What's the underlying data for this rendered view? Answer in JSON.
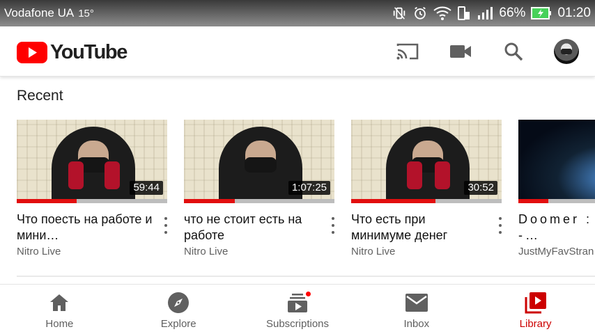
{
  "status_bar": {
    "carrier": "Vodafone UA",
    "temperature": "15°",
    "battery_pct": "66%",
    "time": "01:20"
  },
  "app_bar": {
    "logo_text": "YouTube",
    "icons": [
      "cast-icon",
      "camera-icon",
      "search-icon",
      "avatar"
    ]
  },
  "section": {
    "title": "Recent"
  },
  "videos": [
    {
      "title": "Что поесть на работе и мини…",
      "channel": "Nitro Live",
      "duration": "59:44",
      "progress": 0.4
    },
    {
      "title": "что не стоит есть на работе",
      "channel": "Nitro Live",
      "duration": "1:07:25",
      "progress": 0.34
    },
    {
      "title": "Что есть при минимуме денег",
      "channel": "Nitro Live",
      "duration": "30:52",
      "progress": 0.56
    },
    {
      "title": "Doomer : Кино -…",
      "channel": "JustMyFavStran",
      "duration": "",
      "progress": 0.2
    }
  ],
  "bottom_nav": [
    {
      "label": "Home",
      "icon": "home-icon",
      "active": false
    },
    {
      "label": "Explore",
      "icon": "compass-icon",
      "active": false
    },
    {
      "label": "Subscriptions",
      "icon": "subscriptions-icon",
      "active": false,
      "badge": true
    },
    {
      "label": "Inbox",
      "icon": "mail-icon",
      "active": false
    },
    {
      "label": "Library",
      "icon": "library-icon",
      "active": true
    }
  ],
  "colors": {
    "brand_red": "#ff0000",
    "active_label": "#cc0000",
    "progress": "#e20e0e"
  }
}
